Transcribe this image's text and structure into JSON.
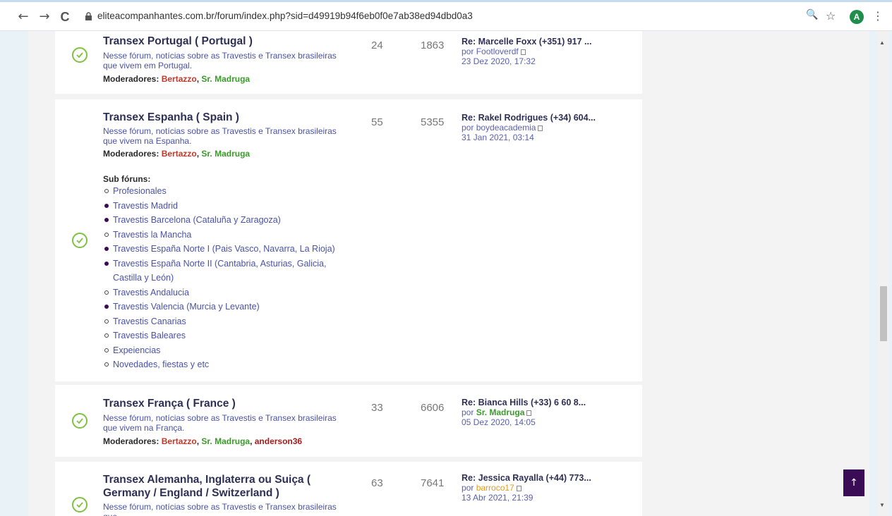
{
  "browser": {
    "url": "eliteacompanhantes.com.br/forum/index.php?sid=d49919b94f6eb0f0e7ab38ed94dbd0a3",
    "back": "←",
    "forward": "→",
    "reload": "C",
    "zoom": "🔍",
    "star": "☆",
    "avatar_letter": "A",
    "menu": "⋮"
  },
  "forums": [
    {
      "title": "Transex Portugal ( Portugal )",
      "desc": "Nesse fórum, notícias sobre as Travestis e Transex brasileiras que vivem em Portugal.",
      "mods_label": "Moderadores:",
      "mods": [
        {
          "name": "Bertazzo",
          "color": "red"
        },
        {
          "name": "Sr. Madruga",
          "color": "green"
        }
      ],
      "topics": "24",
      "posts": "1863",
      "last_title": "Re: Marcelle Foxx (+351) 917 ...",
      "last_by_prefix": "por",
      "last_by": "Footloverdf",
      "last_date": "23 Dez 2020, 17:32"
    },
    {
      "title": "Transex Espanha ( Spain )",
      "desc": "Nesse fórum, notícias sobre as Travestis e Transex brasileiras que vivem na Espanha.",
      "mods_label": "Moderadores:",
      "mods": [
        {
          "name": "Bertazzo",
          "color": "red"
        },
        {
          "name": "Sr. Madruga",
          "color": "green"
        }
      ],
      "topics": "55",
      "posts": "5355",
      "last_title": "Re: Rakel Rodrigues (+34) 604...",
      "last_by_prefix": "por",
      "last_by": "boydeacademia",
      "last_date": "31 Jan 2021, 03:14",
      "sub_label": "Sub fóruns:",
      "subforums": [
        {
          "name": "Profesionales",
          "type": "o"
        },
        {
          "name": "Travestis Madrid",
          "type": "f"
        },
        {
          "name": "Travestis Barcelona (Cataluña y Zaragoza)",
          "type": "f"
        },
        {
          "name": "Travestis la Mancha",
          "type": "o"
        },
        {
          "name": "Travestis España Norte I (Pais Vasco, Navarra, La Rioja)",
          "type": "f"
        },
        {
          "name": "Travestis España Norte II (Cantabria, Asturias, Galicia, Castilla y León)",
          "type": "f"
        },
        {
          "name": "Travestis Andalucia",
          "type": "o"
        },
        {
          "name": "Travestis Valencia (Murcia y Levante)",
          "type": "f"
        },
        {
          "name": "Travestis Canarias",
          "type": "o"
        },
        {
          "name": "Travestis Baleares",
          "type": "o"
        },
        {
          "name": "Expeiencias",
          "type": "o"
        },
        {
          "name": "Novedades, fiestas y etc",
          "type": "o"
        }
      ]
    },
    {
      "title": "Transex França ( France )",
      "desc": "Nesse fórum, notícias sobre as Travestis e Transex brasileiras que vivem na França.",
      "mods_label": "Moderadores:",
      "mods": [
        {
          "name": "Bertazzo",
          "color": "red"
        },
        {
          "name": "Sr. Madruga",
          "color": "green"
        },
        {
          "name": "anderson36",
          "color": "darkred"
        }
      ],
      "topics": "33",
      "posts": "6606",
      "last_title": "Re: Bianca Hills (+33) 6 60 8...",
      "last_by_prefix": "por",
      "last_by": "Sr. Madruga",
      "last_date": "05 Dez 2020, 14:05"
    },
    {
      "title": "Transex Alemanha, Inglaterra ou Suiça ( Germany / England / Switzerland )",
      "desc": "Nesse fórum, notícias sobre as Travestis e Transex brasileiras que",
      "topics": "63",
      "posts": "7641",
      "last_title": "Re: Jessica Rayalla (+44) 773...",
      "last_by_prefix": "por",
      "last_by": "barroco17",
      "last_date": "13 Abr 2021, 21:39"
    }
  ],
  "scroll_top_arrow": "↑"
}
